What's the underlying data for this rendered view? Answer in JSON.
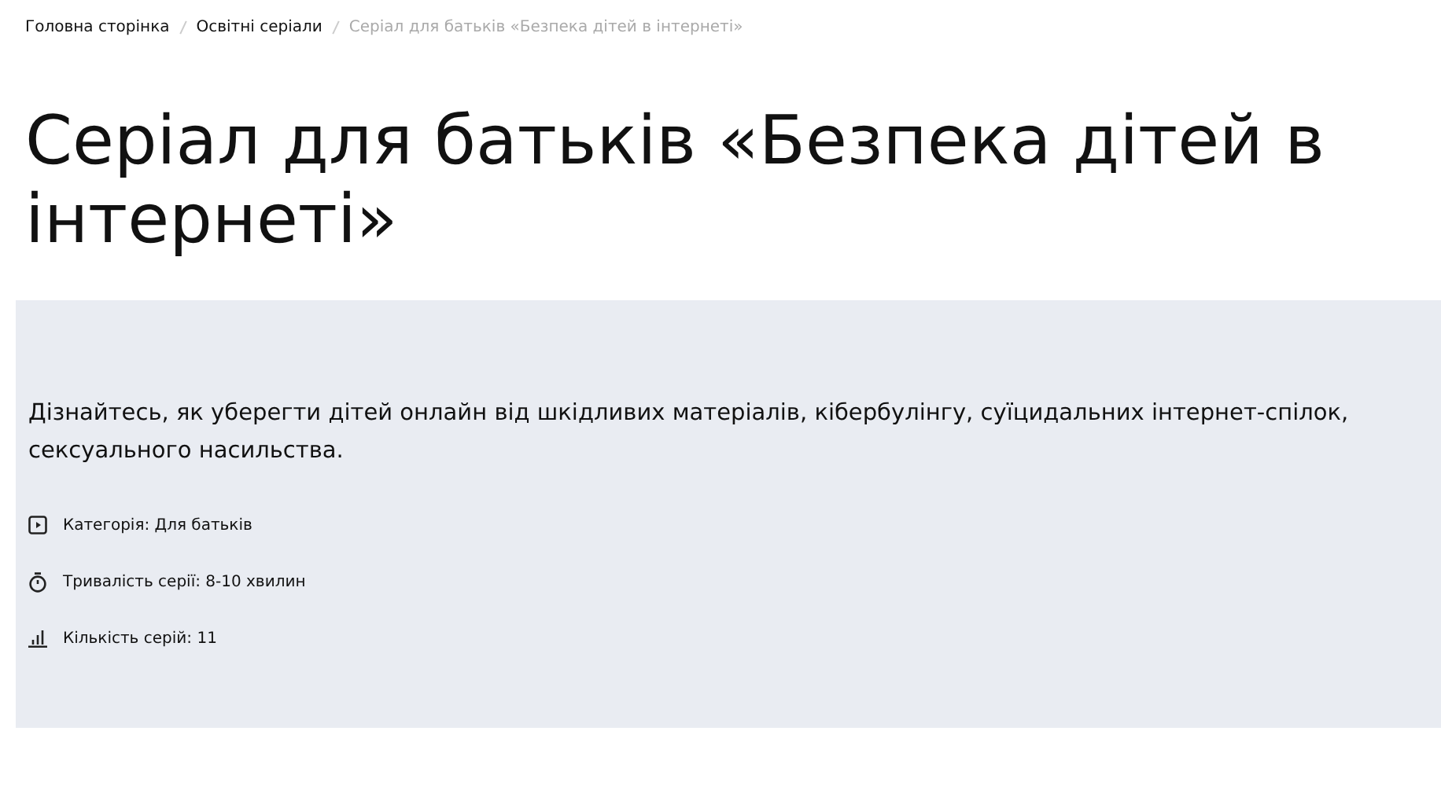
{
  "breadcrumbs": [
    {
      "label": "Головна сторінка",
      "current": false
    },
    {
      "label": "Освітні серіали",
      "current": false
    },
    {
      "label": "Серіал для батьків «Безпека дітей в інтернеті»",
      "current": true
    }
  ],
  "title": "Серіал для батьків «Безпека дітей в інтернеті»",
  "description": "Дізнайтесь, як уберегти дітей онлайн від шкідливих матеріалів, кібербулінгу, суїцидальних інтернет-спілок, сексуального насильства.",
  "meta": [
    {
      "kind": "category",
      "text": "Категорія: Для батьків"
    },
    {
      "kind": "duration",
      "text": "Тривалість серії: 8-10 хвилин"
    },
    {
      "kind": "count",
      "text": "Кількість серій: 11"
    }
  ]
}
